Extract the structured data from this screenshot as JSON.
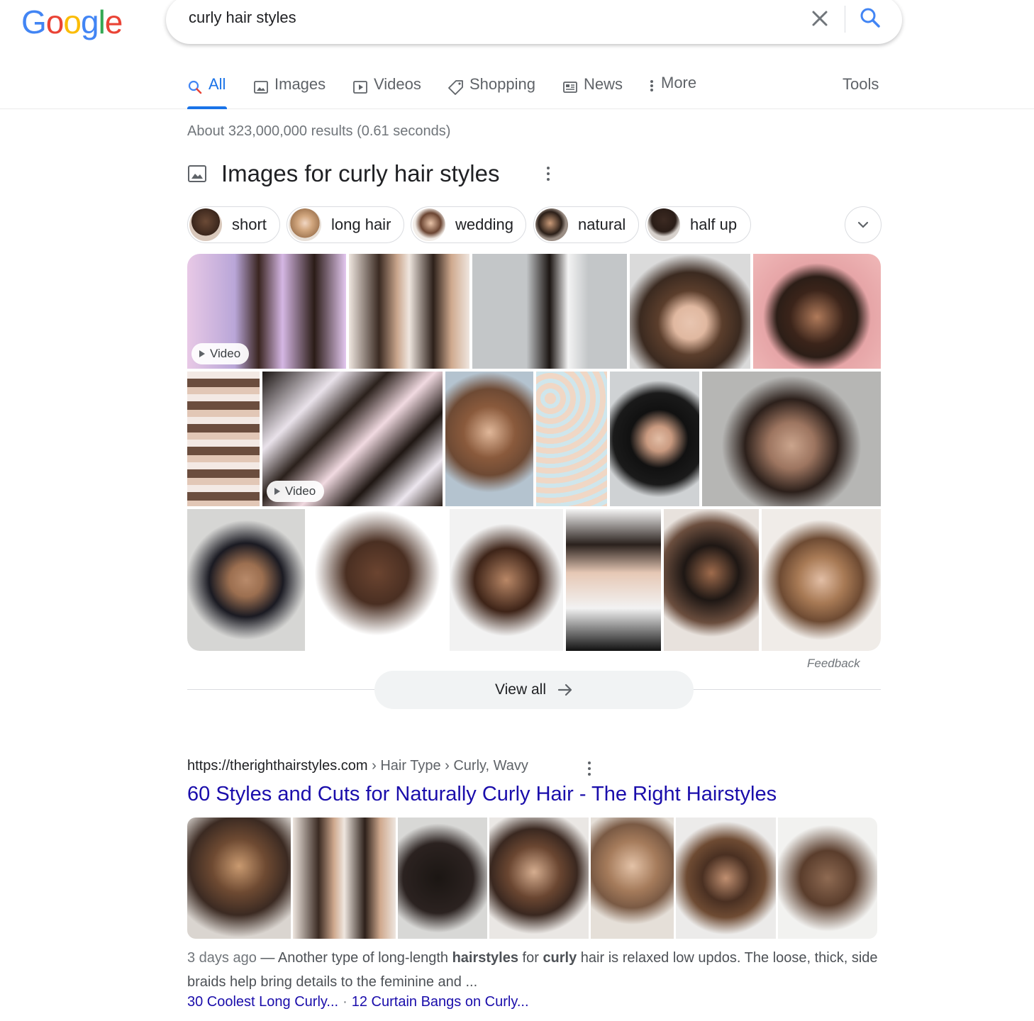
{
  "logo": {
    "text": "Google",
    "letters": [
      "G",
      "o",
      "o",
      "g",
      "l",
      "e"
    ],
    "colors": [
      "#4285F4",
      "#EA4335",
      "#FBBC05",
      "#4285F4",
      "#34A853",
      "#EA4335"
    ]
  },
  "search": {
    "query": "curly hair styles"
  },
  "tabs": [
    {
      "label": "All",
      "icon": "search-icon",
      "active": true
    },
    {
      "label": "Images",
      "icon": "image-icon"
    },
    {
      "label": "Videos",
      "icon": "play-icon"
    },
    {
      "label": "Shopping",
      "icon": "tag-icon"
    },
    {
      "label": "News",
      "icon": "news-icon"
    },
    {
      "label": "More",
      "icon": "more-vert-icon"
    }
  ],
  "tools_label": "Tools",
  "stats": "About 323,000,000 results (0.61 seconds)",
  "images_section": {
    "title": "Images for curly hair styles",
    "chips": [
      "short",
      "long hair",
      "wedding",
      "natural",
      "half up"
    ],
    "video_badge": "Video",
    "feedback": "Feedback",
    "view_all": "View all"
  },
  "result": {
    "url": "https://therighthairstyles.com",
    "breadcrumb": "› Hair Type › Curly, Wavy",
    "title": "60 Styles and Cuts for Naturally Curly Hair - The Right Hairstyles",
    "date": "3 days ago",
    "snippet_parts": [
      {
        "text": " — Another type of long-length ",
        "bold": false
      },
      {
        "text": "hairstyles",
        "bold": true
      },
      {
        "text": " for ",
        "bold": false
      },
      {
        "text": "curly",
        "bold": true
      },
      {
        "text": " hair is relaxed low updos. The loose, thick, side braids help bring details to the feminine and ...",
        "bold": false
      }
    ],
    "sitelinks": [
      "30 Coolest Long Curly...",
      "12 Curtain Bangs on Curly..."
    ]
  },
  "colors": {
    "accent": "#1a73e8",
    "link": "#1a0dab"
  }
}
